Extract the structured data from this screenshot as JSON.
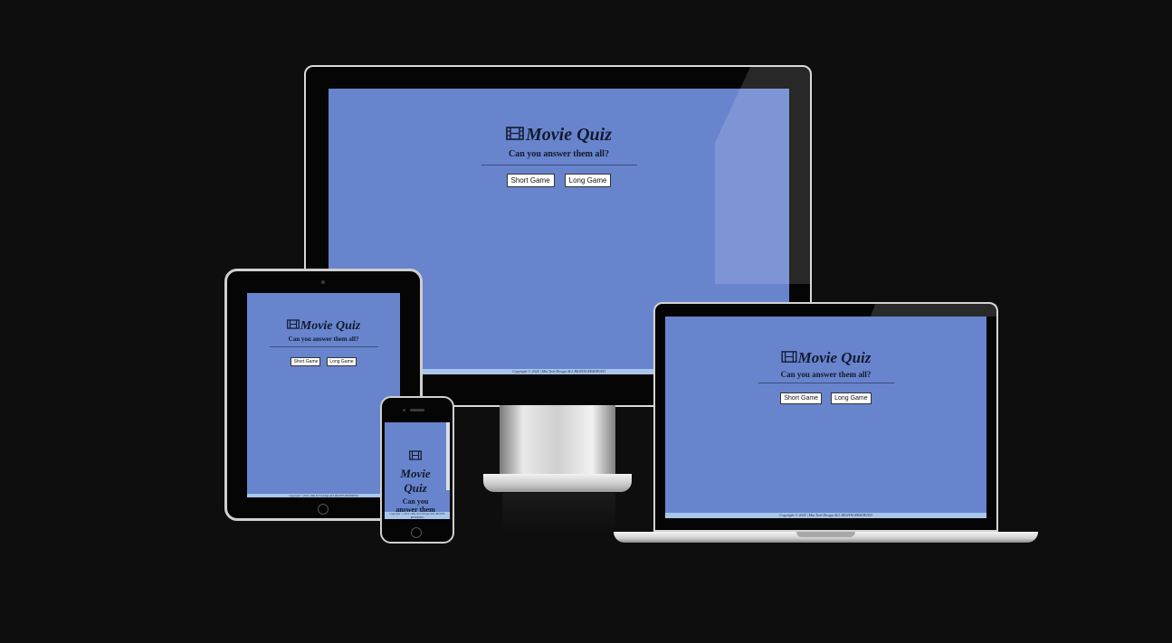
{
  "app": {
    "title": "Movie Quiz",
    "subtitle": "Can you answer them all?",
    "buttons": {
      "short": "Short Game",
      "long": "Long Game"
    },
    "footer": "Copyright © 2024 | Mia Tech Design ALL RIGHTS RESERVED",
    "phone_subtitle": "Can you answer them"
  },
  "colors": {
    "page_background": "#0f0e0e",
    "screen_background": "#6884cd",
    "footer_background": "#a8c6ec",
    "text": "#121a2e"
  },
  "icons": {
    "title_icon": "film-icon"
  }
}
